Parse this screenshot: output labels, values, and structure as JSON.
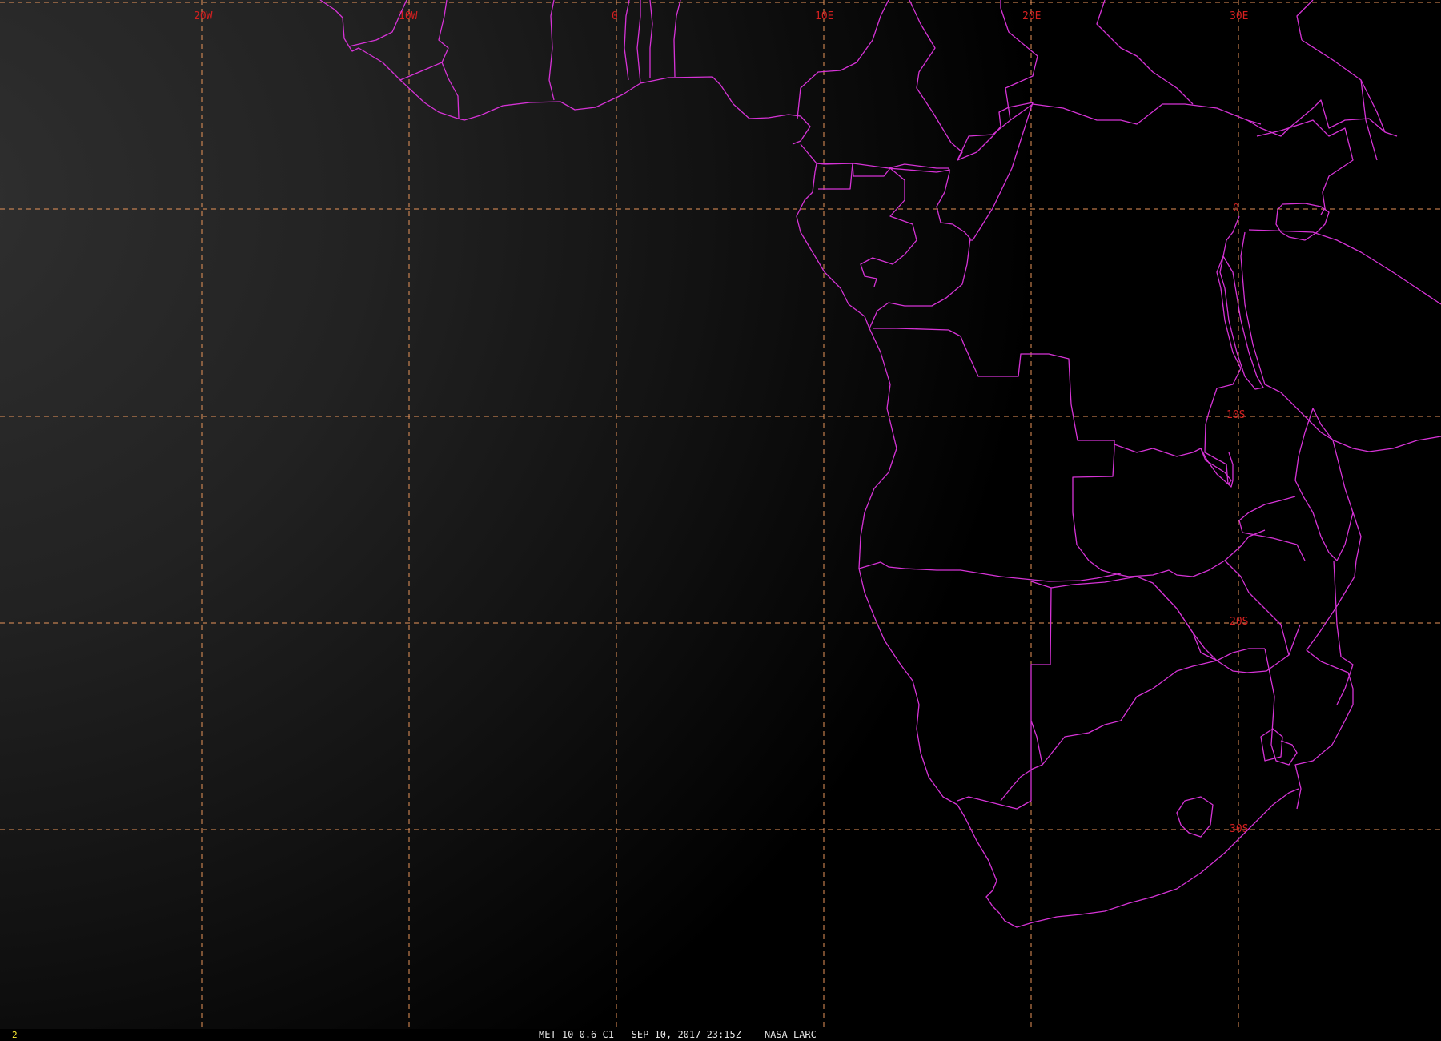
{
  "frame_number": "2",
  "caption": {
    "satellite": "MET-10",
    "band": "0.6",
    "channel": "C1",
    "datetime": "SEP 10, 2017 23:15Z",
    "source": "NASA LARC"
  },
  "grid_labels": {
    "lon": [
      "20W",
      "10W",
      "0",
      "10E",
      "20E",
      "30E"
    ],
    "lat": [
      "0",
      "10S",
      "20S",
      "30S"
    ]
  },
  "colors": {
    "boundary": "#d633d6",
    "grid": "#e8955a",
    "grid_label": "#d42020",
    "frame_number": "#ffee33",
    "caption": "#e6e6e6"
  }
}
